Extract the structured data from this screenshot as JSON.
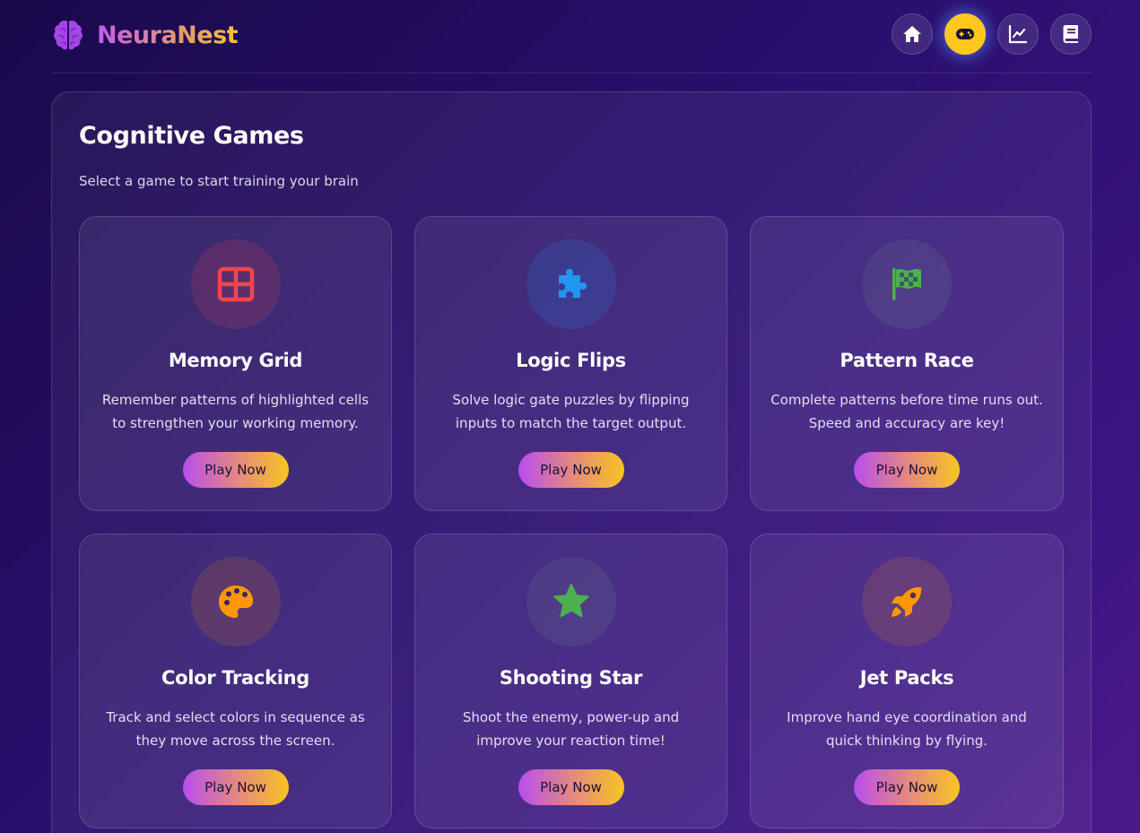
{
  "app": {
    "name": "NeuraNest",
    "logo_icon": "brain-icon"
  },
  "nav": {
    "items": [
      {
        "icon": "home-icon",
        "active": false
      },
      {
        "icon": "gamepad-icon",
        "active": true
      },
      {
        "icon": "chart-line-icon",
        "active": false
      },
      {
        "icon": "book-icon",
        "active": false
      }
    ]
  },
  "main": {
    "title": "Cognitive Games",
    "subtitle": "Select a game to start training your brain",
    "games": [
      {
        "title": "Memory Grid",
        "description": "Remember patterns of highlighted cells to strengthen your working memory.",
        "icon": "grid-icon",
        "icon_color": "#f0454f",
        "button": "Play Now"
      },
      {
        "title": "Logic Flips",
        "description": "Solve logic gate puzzles by flipping inputs to match the target output.",
        "icon": "puzzle-icon",
        "icon_color": "#2196f3",
        "button": "Play Now"
      },
      {
        "title": "Pattern Race",
        "description": "Complete patterns before time runs out. Speed and accuracy are key!",
        "icon": "checkered-flag-icon",
        "icon_color": "#4caf50",
        "button": "Play Now"
      },
      {
        "title": "Color Tracking",
        "description": "Track and select colors in sequence as they move across the screen.",
        "icon": "palette-icon",
        "icon_color": "#ff9800",
        "button": "Play Now"
      },
      {
        "title": "Shooting Star",
        "description": "Shoot the enemy, power-up and improve your reaction time!",
        "icon": "star-icon",
        "icon_color": "#4caf50",
        "button": "Play Now"
      },
      {
        "title": "Jet Packs",
        "description": "Improve hand eye coordination and quick thinking by flying.",
        "icon": "rocket-icon",
        "icon_color": "#ff9800",
        "button": "Play Now"
      }
    ]
  },
  "colors": {
    "accent_yellow": "#ffc81e",
    "accent_purple": "#b84ef0",
    "background": "#2a0f6e"
  }
}
